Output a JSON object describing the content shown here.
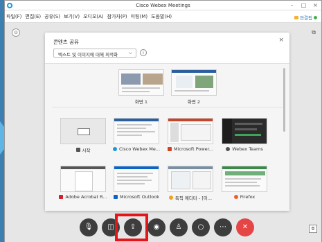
{
  "window": {
    "title": "Cisco Webex Meetings",
    "controls": [
      "–",
      "□",
      "×"
    ]
  },
  "menu": {
    "items": [
      "파일(F)",
      "편집(E)",
      "공유(S)",
      "보기(V)",
      "오디오(A)",
      "참가자(P)",
      "미팅(M)",
      "도움말(H)"
    ],
    "connection": "연결됨"
  },
  "panel": {
    "title": "콘텐츠 공유",
    "optimize_label": "텍스트 및 이미지에 대해 최적화",
    "close": "×",
    "screens": [
      {
        "label": "화면 1"
      },
      {
        "label": "화면 2"
      }
    ],
    "apps": [
      {
        "label": "시작",
        "icon": "start-icon",
        "color": "#555555"
      },
      {
        "label": "Cisco Webex Me...",
        "icon": "webex-meetings-icon",
        "color": "#1c9ad6"
      },
      {
        "label": "Microsoft Power...",
        "icon": "powerpoint-icon",
        "color": "#d04423"
      },
      {
        "label": "Webex Teams",
        "icon": "webex-teams-icon",
        "color": "#555555"
      },
      {
        "label": "Adobe Acrobat R...",
        "icon": "acrobat-icon",
        "color": "#d3202a"
      },
      {
        "label": "Microsoft Outlook",
        "icon": "outlook-icon",
        "color": "#0a64c8"
      },
      {
        "label": "독픽 에디터 - [이...",
        "icon": "editor-icon",
        "color": "#f0a020"
      },
      {
        "label": "Firefox",
        "icon": "firefox-icon",
        "color": "#e8632b"
      }
    ]
  },
  "toolbar": {
    "buttons": [
      {
        "name": "mute",
        "glyph": "🎙"
      },
      {
        "name": "video",
        "glyph": "◫"
      },
      {
        "name": "share",
        "glyph": "⇪"
      },
      {
        "name": "record",
        "glyph": "◉"
      },
      {
        "name": "participants",
        "glyph": "♙"
      },
      {
        "name": "chat",
        "glyph": "○"
      },
      {
        "name": "more",
        "glyph": "⋯"
      },
      {
        "name": "end",
        "glyph": "✕"
      }
    ],
    "highlight_color": "#e5161a"
  }
}
